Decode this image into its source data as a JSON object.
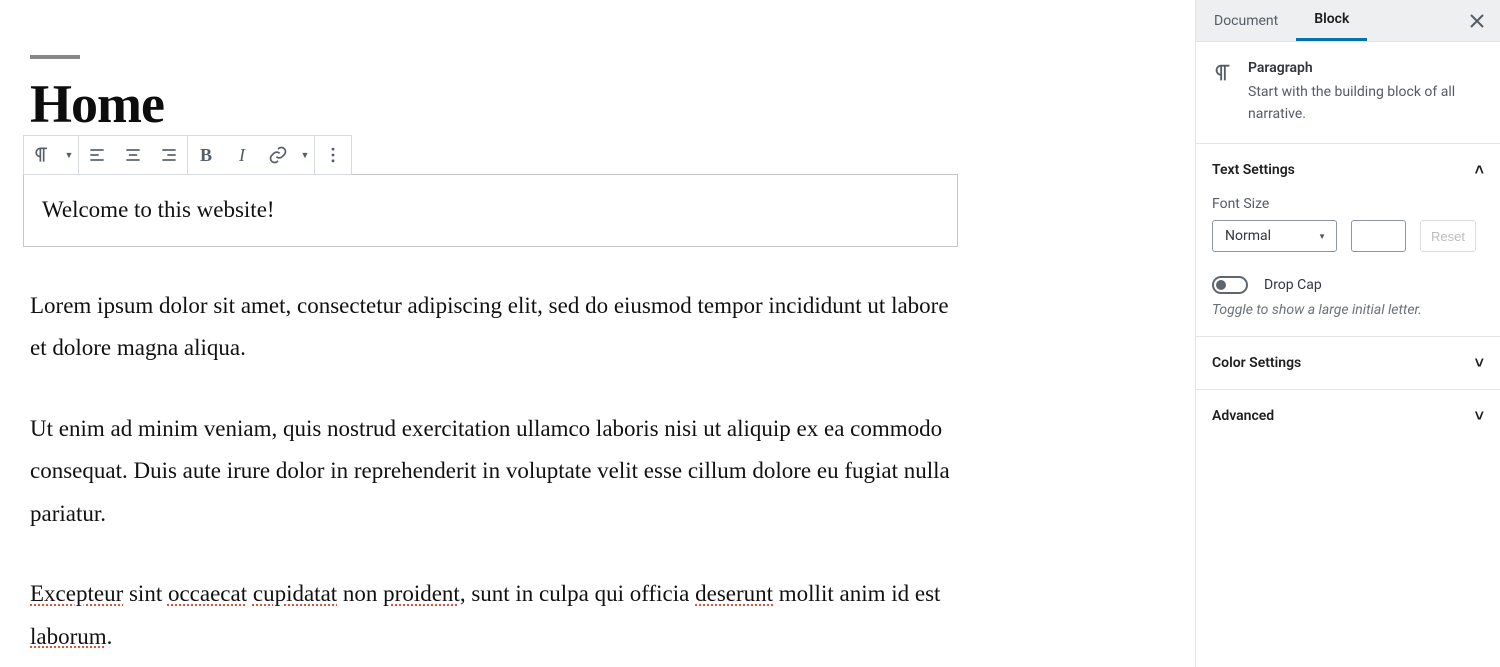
{
  "editor": {
    "page_title": "Home",
    "selected_block": "Welcome to this website!",
    "paragraphs": {
      "p1": "Lorem ipsum dolor sit amet, consectetur adipiscing elit, sed do eiusmod tempor incididunt ut labore et dolore magna aliqua.",
      "p2": "Ut enim ad minim veniam, quis nostrud exercitation ullamco laboris nisi ut aliquip ex ea commodo consequat. Duis aute irure dolor in reprehenderit in voluptate velit esse cillum dolore eu fugiat nulla pariatur.",
      "p3_tokens": {
        "t0": "Excepteur",
        "t1": " sint ",
        "t2": "occaecat",
        "t3": " ",
        "t4": "cupidatat",
        "t5": " non ",
        "t6": "proident",
        "t7": ", sunt in culpa qui officia ",
        "t8": "deserunt",
        "t9": " mollit anim id est ",
        "t10": "laborum",
        "t11": "."
      }
    }
  },
  "toolbar": {
    "block_type_icon": "pilcrow-icon",
    "align_left": "align-left-icon",
    "align_center": "align-center-icon",
    "align_right": "align-right-icon",
    "bold": "B",
    "italic": "I",
    "link": "link-icon",
    "more_rich": "▾",
    "more_opts": "⋮"
  },
  "sidebar": {
    "tabs": {
      "document": "Document",
      "block": "Block"
    },
    "active_tab": "block",
    "block": {
      "title": "Paragraph",
      "description": "Start with the building block of all narrative."
    },
    "panels": {
      "text": {
        "title": "Text Settings",
        "font_size_label": "Font Size",
        "font_size_value": "Normal",
        "custom_size": "",
        "reset_label": "Reset",
        "drop_cap_label": "Drop Cap",
        "drop_cap_hint": "Toggle to show a large initial letter.",
        "drop_cap_on": false
      },
      "color": {
        "title": "Color Settings"
      },
      "advanced": {
        "title": "Advanced"
      }
    }
  }
}
